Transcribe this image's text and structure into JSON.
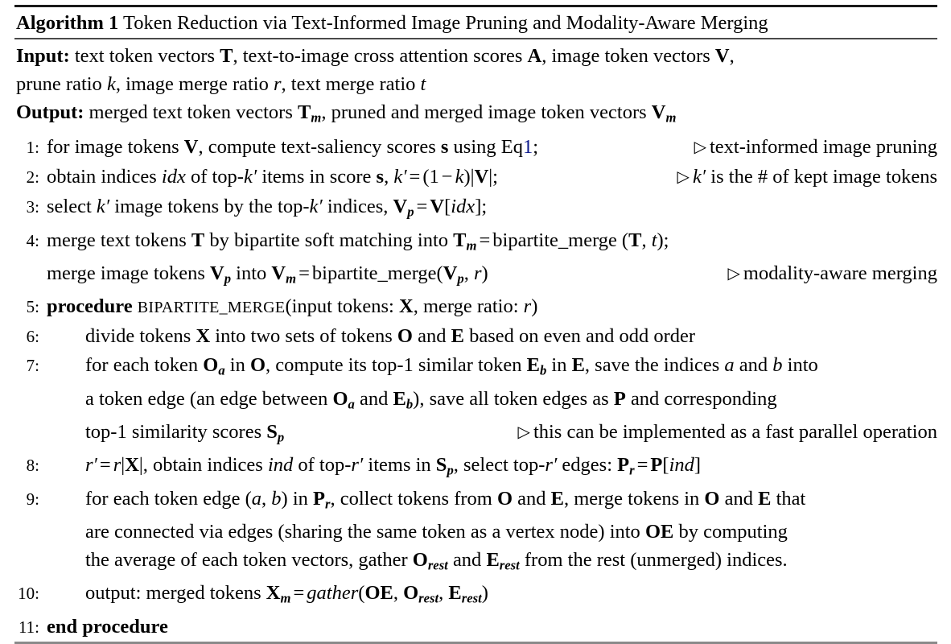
{
  "caption": {
    "label": "Algorithm 1",
    "title": "Token Reduction via Text-Informed Image Pruning and Modality-Aware Merging"
  },
  "io": {
    "input_label": "Input:",
    "input_line1": "text token vectors T, text-to-image cross attention scores A, image token vectors V,",
    "input_line2": "prune ratio k, image merge ratio r, text merge ratio t",
    "output_label": "Output:",
    "output_line": "merged text token vectors T_m, pruned and merged image token vectors V_m"
  },
  "lines": [
    {
      "num": "1:",
      "indent": 0,
      "text": "for image tokens V, compute text-saliency scores s using Eq1;",
      "comment": "text-informed image pruning",
      "link_text": "1"
    },
    {
      "num": "2:",
      "indent": 0,
      "text": "obtain indices idx of top-k' items in score s, k' = (1 - k)|V|;",
      "comment": "k' is the # of kept image tokens"
    },
    {
      "num": "3:",
      "indent": 0,
      "text": "select k' image tokens by the top-k' indices, V_p = V[idx];",
      "comment": ""
    },
    {
      "num": "4:",
      "indent": 0,
      "text": "merge text tokens T by bipartite soft matching into T_m = bipartite_merge(T, t);",
      "comment": ""
    },
    {
      "num": "",
      "indent": 0,
      "text": "merge image tokens V_p into V_m = bipartite_merge(V_p, r)",
      "comment": "modality-aware merging"
    },
    {
      "num": "5:",
      "indent": 0,
      "keyword": "procedure",
      "proc_name": "BIPARTITE_MERGE",
      "text": "procedure BIPARTITE_MERGE(input tokens: X, merge ratio: r)",
      "comment": ""
    },
    {
      "num": "6:",
      "indent": 1,
      "text": "divide tokens X into two sets of tokens O and E based on even and odd order",
      "comment": ""
    },
    {
      "num": "7:",
      "indent": 1,
      "text": "for each token O_a in O, compute its top-1 similar token E_b in E, save the indices a and b into",
      "comment": ""
    },
    {
      "num": "",
      "indent": 1,
      "text": "a token edge (an edge between O_a and E_b), save all token edges as P and corresponding",
      "comment": ""
    },
    {
      "num": "",
      "indent": 1,
      "text": "top-1 similarity scores S_p",
      "comment": "this can be implemented as a fast parallel operation"
    },
    {
      "num": "8:",
      "indent": 1,
      "text": "r' = r|X|, obtain indices ind of top-r' items in S_p, select top-r' edges: P_r = P[ind]",
      "comment": ""
    },
    {
      "num": "9:",
      "indent": 1,
      "text": "for each token edge (a, b) in P_r, collect tokens from O and E, merge tokens in O and E that",
      "comment": ""
    },
    {
      "num": "",
      "indent": 1,
      "text": "are connected via edges (sharing the same token as a vertex node) into OE by computing",
      "comment": ""
    },
    {
      "num": "",
      "indent": 1,
      "text": "the average of each token vectors, gather O_rest and E_rest from the rest (unmerged) indices.",
      "comment": ""
    },
    {
      "num": "10:",
      "indent": 1,
      "text": "output: merged tokens X_m = gather(OE, O_rest, E_rest)",
      "comment": ""
    },
    {
      "num": "11:",
      "indent": 0,
      "keyword": "end procedure",
      "text": "end procedure",
      "comment": ""
    }
  ],
  "symbols": {
    "comment_marker": "▷",
    "link_color": "#0d1a8c"
  }
}
